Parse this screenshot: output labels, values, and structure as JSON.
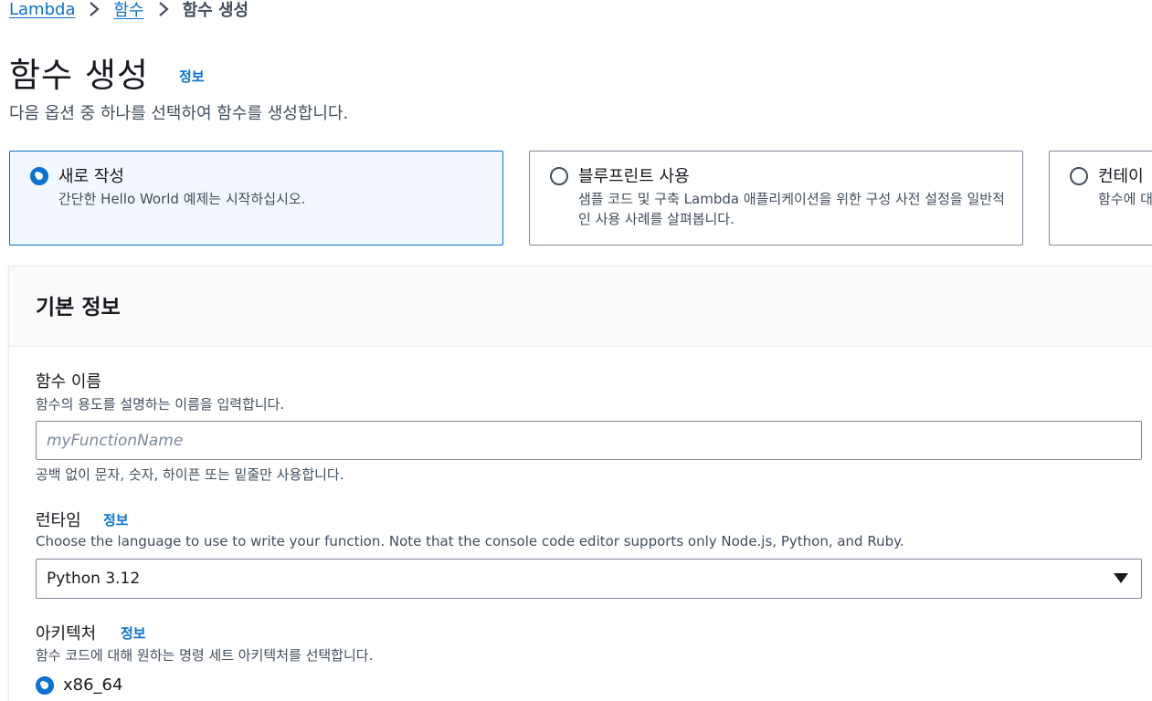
{
  "breadcrumb": {
    "items": [
      "Lambda",
      "함수"
    ],
    "current": "함수 생성"
  },
  "header": {
    "title": "함수 생성",
    "info": "정보",
    "description": "다음 옵션 중 하나를 선택하여 함수를 생성합니다."
  },
  "options": [
    {
      "title": "새로 작성",
      "description": "간단한 Hello World 예제는 시작하십시오.",
      "selected": true
    },
    {
      "title": "블루프린트 사용",
      "description": "샘플 코드 및 구축 Lambda 애플리케이션을 위한 구성 사전 설정을 일반적인 사용 사례를 살펴봅니다.",
      "selected": false
    },
    {
      "title": "컨테이",
      "description": "함수에 대",
      "selected": false
    }
  ],
  "basic_info": {
    "title": "기본 정보",
    "function_name": {
      "label": "함수 이름",
      "description": "함수의 용도를 설명하는 이름을 입력합니다.",
      "placeholder": "myFunctionName",
      "value": "",
      "constraint": "공백 없이 문자, 숫자, 하이픈 또는 밑줄만 사용합니다."
    },
    "runtime": {
      "label": "런타임",
      "info": "정보",
      "description": "Choose the language to use to write your function. Note that the console code editor supports only Node.js, Python, and Ruby.",
      "selected": "Python 3.12"
    },
    "architecture": {
      "label": "아키텍처",
      "info": "정보",
      "description": "함수 코드에 대해 원하는 명령 세트 아키텍처를 선택합니다.",
      "options": [
        "x86_64"
      ]
    }
  },
  "colors": {
    "accent": "#0972d3",
    "selected_tile_bg": "#f2f8fd"
  }
}
